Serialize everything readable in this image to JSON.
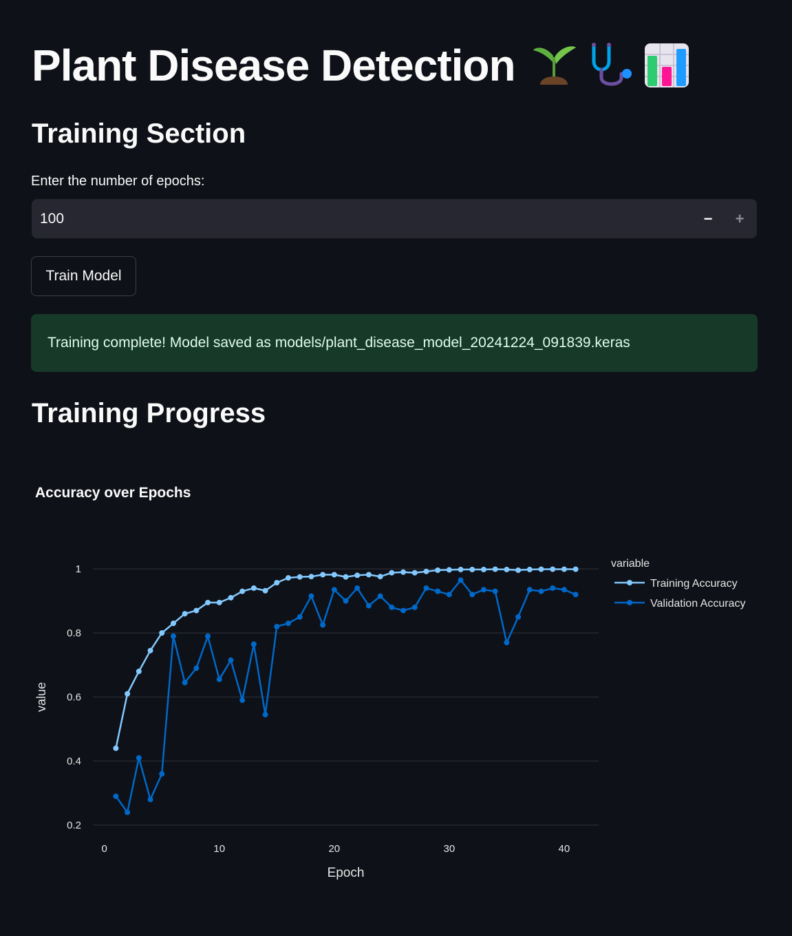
{
  "title": "Plant Disease Detection",
  "title_icons": [
    "seedling-icon",
    "stethoscope-icon",
    "bar-chart-icon"
  ],
  "training_section": {
    "heading": "Training Section",
    "epochs_label": "Enter the number of epochs:",
    "epochs_value": "100",
    "decrement_label": "−",
    "increment_label": "+",
    "train_button": "Train Model"
  },
  "success_message": "Training complete! Model saved as models/plant_disease_model_20241224_091839.keras",
  "progress_heading": "Training Progress",
  "colors": {
    "background": "#0e1117",
    "input_bg": "#262730",
    "success_bg": "#173928",
    "training_series": "#83c9ff",
    "validation_series": "#0068c9"
  },
  "chart_data": {
    "type": "line",
    "title": "Accuracy over Epochs",
    "xlabel": "Epoch",
    "ylabel": "value",
    "xlim": [
      -1,
      43
    ],
    "ylim": [
      0.2,
      1.0
    ],
    "x_ticks": [
      0,
      10,
      20,
      30,
      40
    ],
    "y_ticks": [
      0.2,
      0.4,
      0.6,
      0.8,
      1
    ],
    "grid": true,
    "legend_title": "variable",
    "legend_position": "right",
    "x": [
      1,
      2,
      3,
      4,
      5,
      6,
      7,
      8,
      9,
      10,
      11,
      12,
      13,
      14,
      15,
      16,
      17,
      18,
      19,
      20,
      21,
      22,
      23,
      24,
      25,
      26,
      27,
      28,
      29,
      30,
      31,
      32,
      33,
      34,
      35,
      36,
      37,
      38,
      39,
      40,
      41
    ],
    "series": [
      {
        "name": "Training Accuracy",
        "color": "#83c9ff",
        "values": [
          0.44,
          0.61,
          0.68,
          0.745,
          0.8,
          0.83,
          0.86,
          0.87,
          0.895,
          0.895,
          0.91,
          0.93,
          0.94,
          0.932,
          0.957,
          0.972,
          0.975,
          0.976,
          0.982,
          0.982,
          0.975,
          0.98,
          0.982,
          0.976,
          0.988,
          0.99,
          0.988,
          0.992,
          0.996,
          0.997,
          0.998,
          0.998,
          0.998,
          0.999,
          0.998,
          0.996,
          0.998,
          0.999,
          0.999,
          0.999,
          0.999
        ]
      },
      {
        "name": "Validation Accuracy",
        "color": "#0068c9",
        "values": [
          0.29,
          0.24,
          0.41,
          0.28,
          0.36,
          0.79,
          0.645,
          0.69,
          0.79,
          0.655,
          0.715,
          0.59,
          0.765,
          0.545,
          0.82,
          0.83,
          0.85,
          0.915,
          0.825,
          0.935,
          0.9,
          0.94,
          0.885,
          0.915,
          0.88,
          0.87,
          0.88,
          0.94,
          0.93,
          0.92,
          0.965,
          0.92,
          0.935,
          0.93,
          0.77,
          0.85,
          0.935,
          0.93,
          0.94,
          0.935,
          0.92
        ]
      }
    ]
  }
}
